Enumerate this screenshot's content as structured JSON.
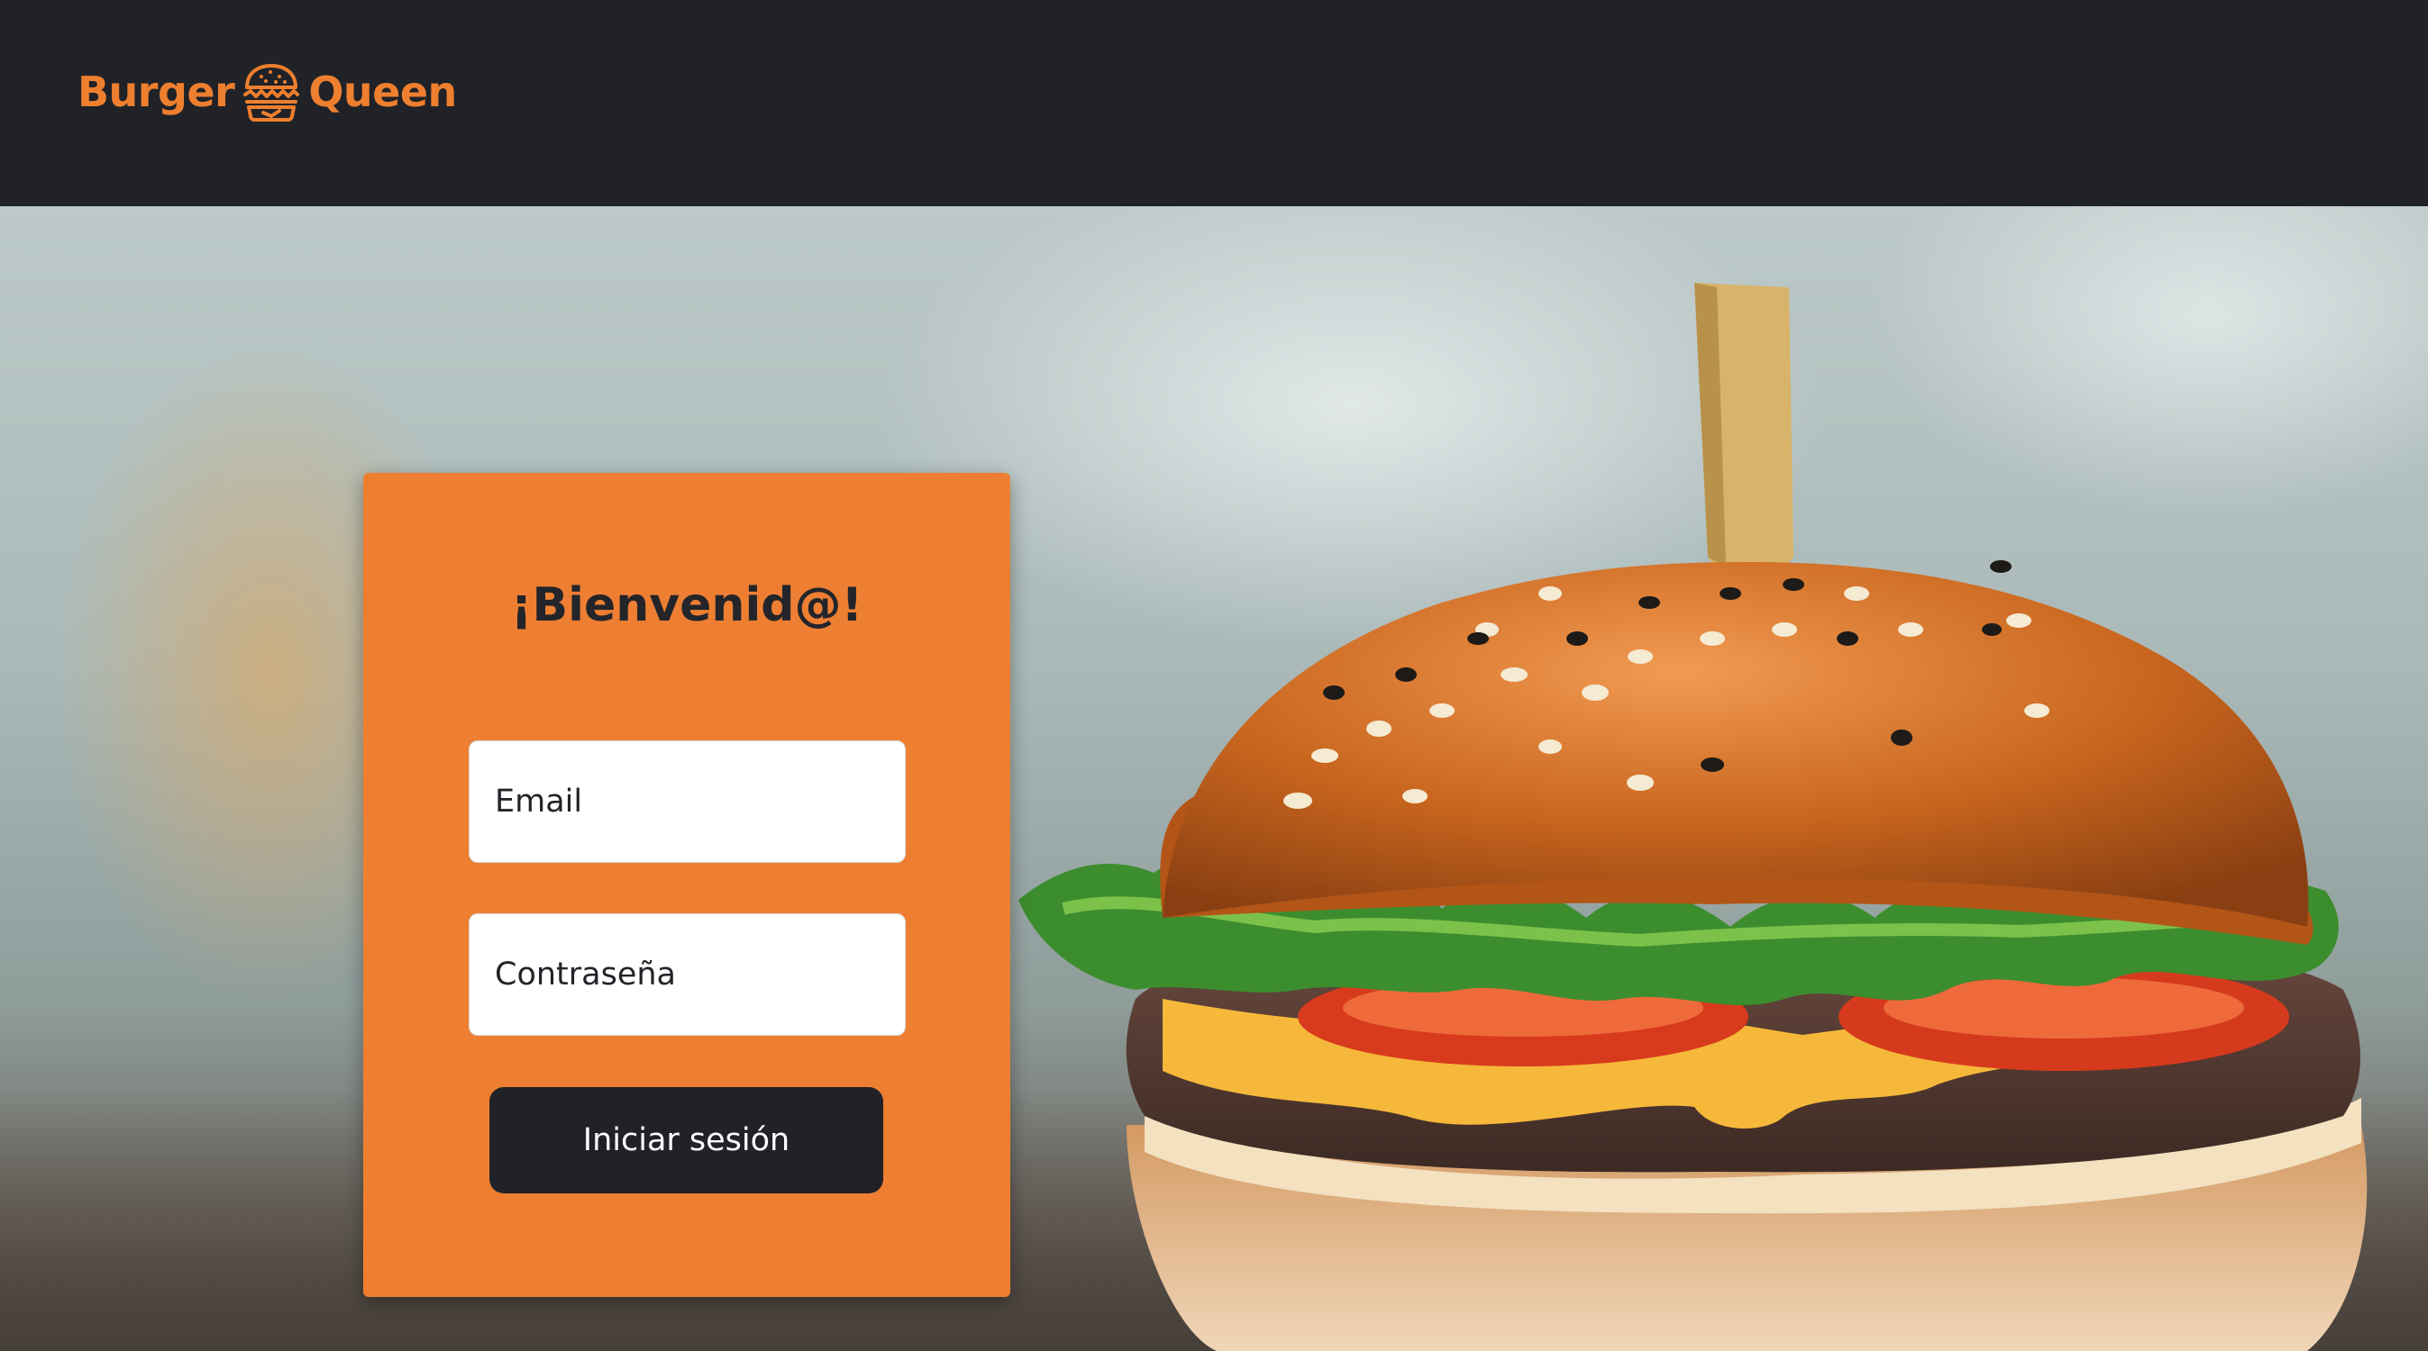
{
  "header": {
    "logo": {
      "text_left": "Burger",
      "text_right": "Queen",
      "icon": "burger-icon",
      "color": "#ee7f2f"
    },
    "background": "#202227"
  },
  "hero": {
    "image": "burger-photo"
  },
  "login": {
    "title": "¡Bienvenid@!",
    "email_placeholder": "Email",
    "password_placeholder": "Contraseña",
    "submit_label": "Iniciar sesión",
    "card_color": "#ee7f32",
    "button_color": "#202227"
  }
}
